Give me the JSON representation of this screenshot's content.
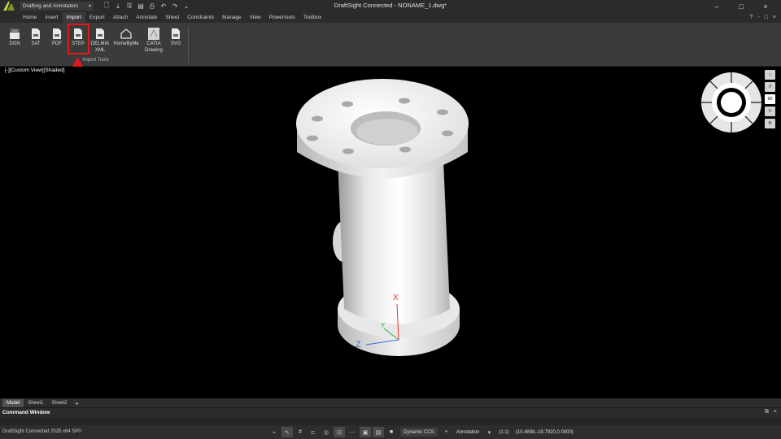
{
  "window": {
    "title": "DraftSight Connected - NONAME_1.dwg*",
    "workspace": "Drafting and Annotation",
    "controls": [
      "–",
      "□",
      "×"
    ]
  },
  "menu": {
    "tabs": [
      "Home",
      "Insert",
      "Import",
      "Export",
      "Attach",
      "Annotate",
      "Sheet",
      "Constraints",
      "Manage",
      "View",
      "Powertools",
      "Toolbox"
    ],
    "active": "Import",
    "right_icons": [
      "?",
      "-",
      "□",
      "×"
    ]
  },
  "ribbon": {
    "buttons": [
      {
        "label": "DGN",
        "icon": "dgn-file-icon"
      },
      {
        "label": "SAT",
        "icon": "sat-file-icon"
      },
      {
        "label": "PDF",
        "icon": "pdf-file-icon"
      },
      {
        "label": "STEP",
        "icon": "step-file-icon"
      },
      {
        "label": "DELMIA\nXML",
        "icon": "delmia-file-icon"
      },
      {
        "label": "HomeByMe",
        "icon": "home-icon"
      },
      {
        "label": "CATIA\nDrawing",
        "icon": "catia-drawing-icon"
      },
      {
        "label": "SVG",
        "icon": "svg-file-icon"
      }
    ],
    "group_label": "Import Tools",
    "highlighted": "STEP"
  },
  "viewport": {
    "label": "[-][Custom View][Shaded]",
    "axes": {
      "x": "X",
      "y": "Y",
      "z": "Z"
    },
    "zoom_value": "90"
  },
  "sheets": {
    "tabs": [
      "Model",
      "Sheet1",
      "Sheet2"
    ],
    "active": "Model",
    "add": "+"
  },
  "command_window": {
    "title": "Command Window",
    "controls": [
      "⧉",
      "×"
    ]
  },
  "status": {
    "app": "DraftSight Connected 2025  x64 SP0",
    "ccs": "Dynamic CCS",
    "annotation": "Annotation",
    "scale": "(1:1)",
    "coords": "(10.4898,-19.7920,0.0000)"
  },
  "colors": {
    "highlight": "#e0191f",
    "ribbon_bg": "#3b3b3b",
    "viewport_bg": "#000000",
    "axis_x": "#e03030",
    "axis_y": "#30b040",
    "axis_z": "#3a6fd8"
  }
}
